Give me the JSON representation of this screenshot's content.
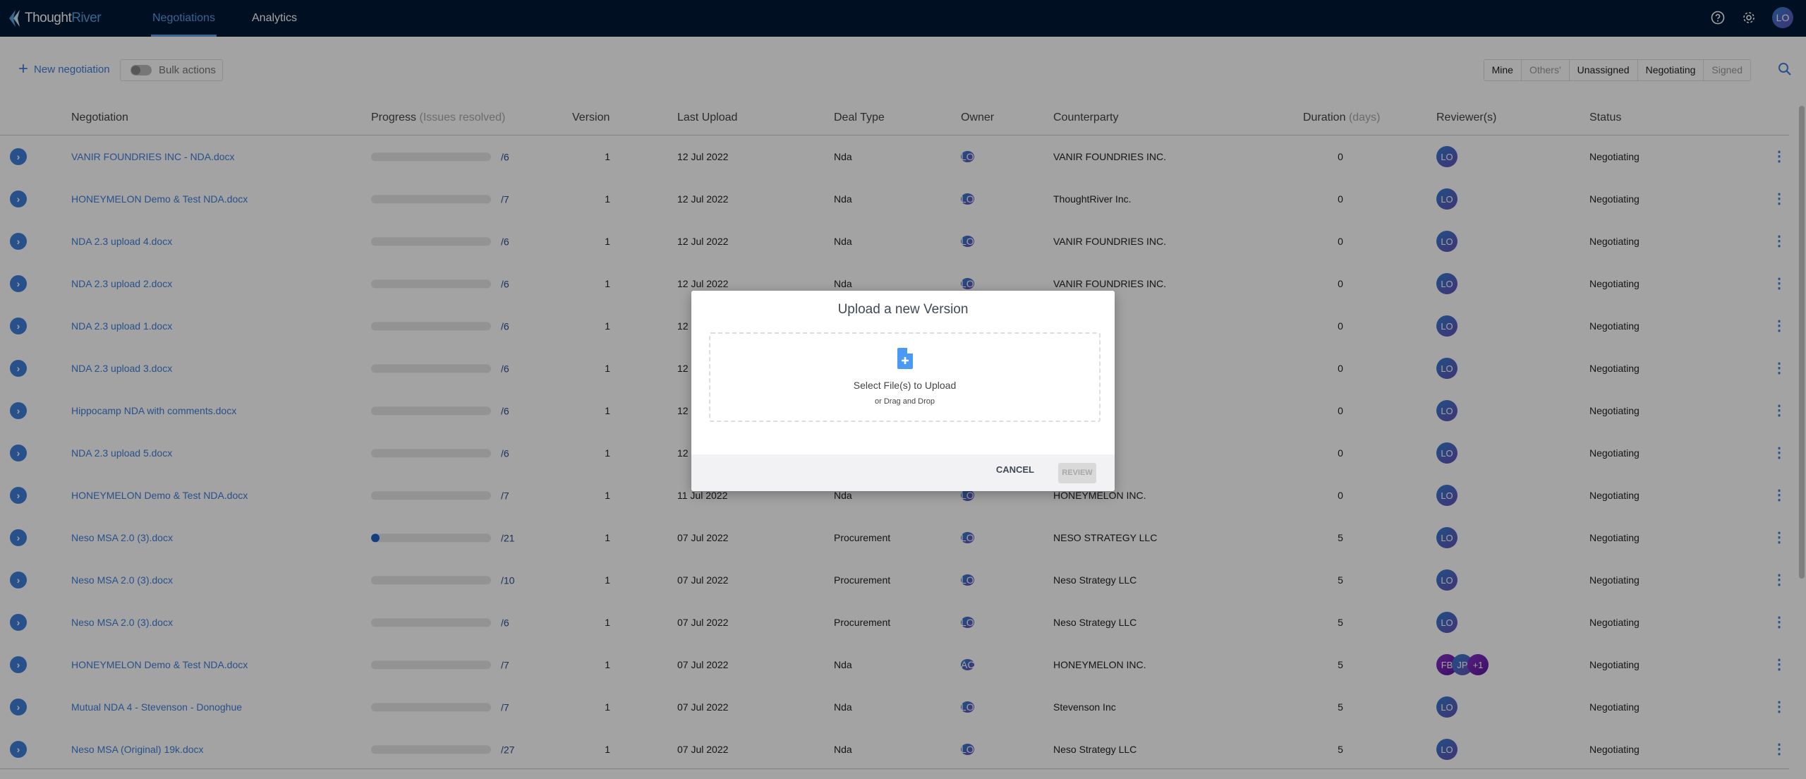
{
  "nav": {
    "brand_a": "Thought",
    "brand_b": "River",
    "tabs": [
      {
        "label": "Negotiations",
        "active": true
      },
      {
        "label": "Analytics",
        "active": false
      }
    ],
    "icons": [
      "help-circle-icon",
      "gear-icon"
    ],
    "user_initials": "LO"
  },
  "toolbar": {
    "new_negotiation": "New negotiation",
    "bulk_actions": "Bulk actions",
    "bulk_enabled": false,
    "filters": [
      {
        "label": "Mine",
        "active": true
      },
      {
        "label": "Others'",
        "active": false
      },
      {
        "label": "Unassigned",
        "active": true
      },
      {
        "label": "Negotiating",
        "active": true
      },
      {
        "label": "Signed",
        "active": false
      }
    ]
  },
  "table": {
    "headers": {
      "negotiation": "Negotiation",
      "progress": "Progress",
      "progress_hint": "(Issues resolved)",
      "version": "Version",
      "last_upload": "Last Upload",
      "deal_type": "Deal Type",
      "owner": "Owner",
      "counterparty": "Counterparty",
      "duration": "Duration",
      "duration_hint": "(days)",
      "reviewers": "Reviewer(s)",
      "status": "Status"
    },
    "rows": [
      {
        "name": "VANIR FOUNDRIES INC - NDA.docx",
        "progress": 0,
        "total": "/6",
        "version": "1",
        "date": "12 Jul 2022",
        "deal": "Nda",
        "owner": "LO",
        "counterparty": "VANIR FOUNDRIES INC.",
        "duration": "0",
        "reviewers": [
          "LO"
        ],
        "status": "Negotiating"
      },
      {
        "name": "HONEYMELON Demo & Test NDA.docx",
        "progress": 0,
        "total": "/7",
        "version": "1",
        "date": "12 Jul 2022",
        "deal": "Nda",
        "owner": "LO",
        "counterparty": "ThoughtRiver Inc.",
        "duration": "0",
        "reviewers": [
          "LO"
        ],
        "status": "Negotiating"
      },
      {
        "name": "NDA 2.3 upload 4.docx",
        "progress": 0,
        "total": "/6",
        "version": "1",
        "date": "12 Jul 2022",
        "deal": "Nda",
        "owner": "LO",
        "counterparty": "VANIR FOUNDRIES INC.",
        "duration": "0",
        "reviewers": [
          "LO"
        ],
        "status": "Negotiating"
      },
      {
        "name": "NDA 2.3 upload 2.docx",
        "progress": 0,
        "total": "/6",
        "version": "1",
        "date": "12 Jul 2022",
        "deal": "Nda",
        "owner": "LO",
        "counterparty": "VANIR FOUNDRIES INC.",
        "duration": "0",
        "reviewers": [
          "LO"
        ],
        "status": "Negotiating"
      },
      {
        "name": "NDA 2.3 upload 1.docx",
        "progress": 0,
        "total": "/6",
        "version": "1",
        "date": "12",
        "deal": "",
        "owner": "",
        "counterparty": "DRIES INC.",
        "duration": "0",
        "reviewers": [
          "LO"
        ],
        "status": "Negotiating"
      },
      {
        "name": "NDA 2.3 upload 3.docx",
        "progress": 0,
        "total": "/6",
        "version": "1",
        "date": "12",
        "deal": "",
        "owner": "",
        "counterparty": "DRIES INC.",
        "duration": "0",
        "reviewers": [
          "LO"
        ],
        "status": "Negotiating"
      },
      {
        "name": "Hippocamp NDA with comments.docx",
        "progress": 0,
        "total": "/6",
        "version": "1",
        "date": "12",
        "deal": "",
        "owner": "",
        "counterparty": "sel",
        "duration": "0",
        "reviewers": [
          "LO"
        ],
        "status": "Negotiating"
      },
      {
        "name": "NDA 2.3 upload 5.docx",
        "progress": 0,
        "total": "/6",
        "version": "1",
        "date": "12",
        "deal": "",
        "owner": "",
        "counterparty": "DRIES INC.",
        "duration": "0",
        "reviewers": [
          "LO"
        ],
        "status": "Negotiating"
      },
      {
        "name": "HONEYMELON Demo & Test NDA.docx",
        "progress": 0,
        "total": "/7",
        "version": "1",
        "date": "11 Jul 2022",
        "deal": "Nda",
        "owner": "LO",
        "counterparty": "HONEYMELON INC.",
        "duration": "0",
        "reviewers": [
          "LO"
        ],
        "status": "Negotiating"
      },
      {
        "name": "Neso MSA 2.0 (3).docx",
        "progress": 0.05,
        "total": "/21",
        "version": "1",
        "date": "07 Jul 2022",
        "deal": "Procurement",
        "owner": "LO",
        "counterparty": "NESO STRATEGY LLC",
        "duration": "5",
        "reviewers": [
          "LO"
        ],
        "status": "Negotiating"
      },
      {
        "name": "Neso MSA 2.0 (3).docx",
        "progress": 0,
        "total": "/10",
        "version": "1",
        "date": "07 Jul 2022",
        "deal": "Procurement",
        "owner": "LO",
        "counterparty": "Neso Strategy LLC",
        "duration": "5",
        "reviewers": [
          "LO"
        ],
        "status": "Negotiating"
      },
      {
        "name": "Neso MSA 2.0 (3).docx",
        "progress": 0,
        "total": "/6",
        "version": "1",
        "date": "07 Jul 2022",
        "deal": "Procurement",
        "owner": "LO",
        "counterparty": "Neso Strategy LLC",
        "duration": "5",
        "reviewers": [
          "LO"
        ],
        "status": "Negotiating"
      },
      {
        "name": "HONEYMELON Demo & Test NDA.docx",
        "progress": 0,
        "total": "/7",
        "version": "1",
        "date": "07 Jul 2022",
        "deal": "Nda",
        "owner": "AC",
        "counterparty": "HONEYMELON INC.",
        "duration": "5",
        "reviewers": [
          "FB",
          "JP",
          "+1"
        ],
        "status": "Negotiating"
      },
      {
        "name": "Mutual NDA 4 - Stevenson - Donoghue",
        "progress": 0,
        "total": "/7",
        "version": "1",
        "date": "07 Jul 2022",
        "deal": "Nda",
        "owner": "LO",
        "counterparty": "Stevenson Inc",
        "duration": "5",
        "reviewers": [
          "LO"
        ],
        "status": "Negotiating"
      },
      {
        "name": "Neso MSA (Original) 19k.docx",
        "progress": 0,
        "total": "/27",
        "version": "1",
        "date": "07 Jul 2022",
        "deal": "Nda",
        "owner": "LO",
        "counterparty": "Neso Strategy LLC",
        "duration": "5",
        "reviewers": [
          "LO"
        ],
        "status": "Negotiating"
      }
    ]
  },
  "modal": {
    "title": "Upload a new Version",
    "select_files": "Select File(s) to Upload",
    "drag_drop": "or Drag and Drop",
    "cancel": "CANCEL",
    "review": "REVIEW",
    "review_enabled": false
  },
  "colors": {
    "accent": "#3f7ed8",
    "nav_bg": "#001936",
    "progress_fill": "#1f62c9"
  }
}
